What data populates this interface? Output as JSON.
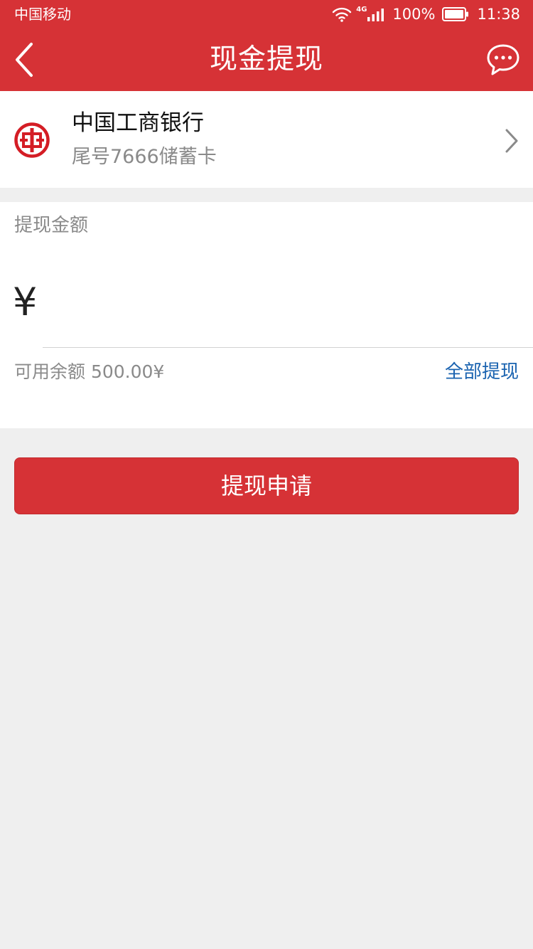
{
  "status_bar": {
    "carrier": "中国移动",
    "network": "4G",
    "battery": "100%",
    "time": "11:38"
  },
  "nav": {
    "title": "现金提现",
    "back_icon": "chevron-left-icon",
    "message_icon": "chat-bubble-icon"
  },
  "bank": {
    "name": "中国工商银行",
    "card_info": "尾号7666储蓄卡",
    "logo_icon": "icbc-logo-icon"
  },
  "amount": {
    "label": "提现金额",
    "currency": "¥",
    "value": "",
    "available": "可用余额 500.00¥",
    "withdraw_all": "全部提现"
  },
  "submit": {
    "label": "提现申请"
  },
  "colors": {
    "primary": "#d63236",
    "link": "#1a63b0",
    "muted_text": "#8a8a8a",
    "background": "#efefef"
  }
}
